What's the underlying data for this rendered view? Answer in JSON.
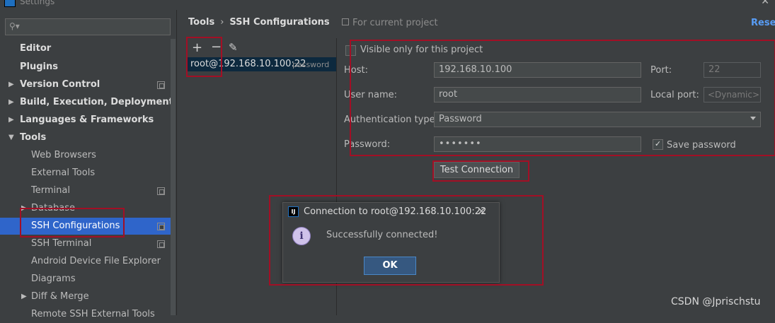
{
  "window": {
    "title": "Settings"
  },
  "sidebar": {
    "search_placeholder": "",
    "items": [
      {
        "label": "Editor"
      },
      {
        "label": "Plugins"
      },
      {
        "label": "Version Control"
      },
      {
        "label": "Build, Execution, Deployment"
      },
      {
        "label": "Languages & Frameworks"
      },
      {
        "label": "Tools"
      },
      {
        "label": "Web Browsers"
      },
      {
        "label": "External Tools"
      },
      {
        "label": "Terminal"
      },
      {
        "label": "Database"
      },
      {
        "label": "SSH Configurations"
      },
      {
        "label": "SSH Terminal"
      },
      {
        "label": "Android Device File Explorer"
      },
      {
        "label": "Diagrams"
      },
      {
        "label": "Diff & Merge"
      },
      {
        "label": "Remote SSH External Tools"
      }
    ]
  },
  "header": {
    "crumb_parent": "Tools",
    "crumb_sep": "›",
    "crumb_current": "SSH Configurations",
    "scope": "For current project",
    "reset": "Reset"
  },
  "config_list": {
    "add": "+",
    "remove": "−",
    "edit": "✎",
    "entry_host": "root@192.168.10.100:22",
    "entry_type": "password"
  },
  "form": {
    "visible_only": "Visible only for this project",
    "host_label": "Host:",
    "host_value": "192.168.10.100",
    "port_label": "Port:",
    "port_value": "22",
    "user_label": "User name:",
    "user_value": "root",
    "local_port_label": "Local port:",
    "local_port_value": "<Dynamic>",
    "auth_label": "Authentication type:",
    "auth_value": "Password",
    "password_label": "Password:",
    "password_value": "•••••••",
    "save_password": "Save password",
    "test_button": "Test Connection"
  },
  "dialog": {
    "title": "Connection to root@192.168.10.100:22",
    "message": "Successfully connected!",
    "ok": "OK",
    "close": "✕",
    "info": "i"
  },
  "watermark": "CSDN @Jprischstu",
  "colors": {
    "annotation": "#a20f25",
    "selection": "#2f65ca",
    "link": "#589df6"
  }
}
